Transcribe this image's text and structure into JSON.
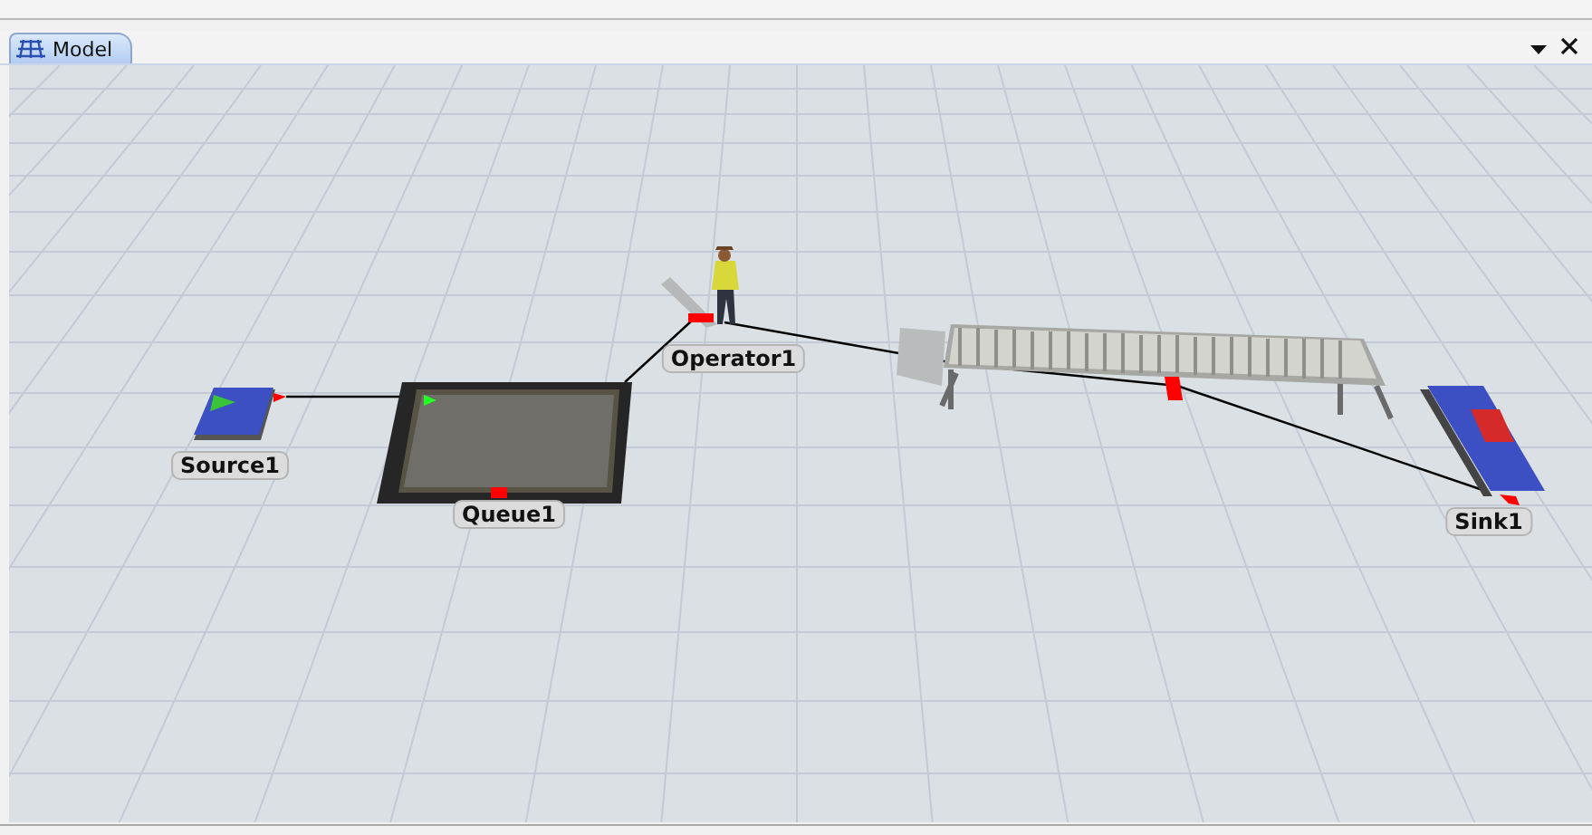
{
  "tabs": [
    {
      "label": "Model",
      "selected": true
    }
  ],
  "objects": [
    {
      "kind": "source",
      "label": "Source1"
    },
    {
      "kind": "queue",
      "label": "Queue1"
    },
    {
      "kind": "operator",
      "label": "Operator1"
    },
    {
      "kind": "conveyor"
    },
    {
      "kind": "sink",
      "label": "Sink1"
    }
  ]
}
